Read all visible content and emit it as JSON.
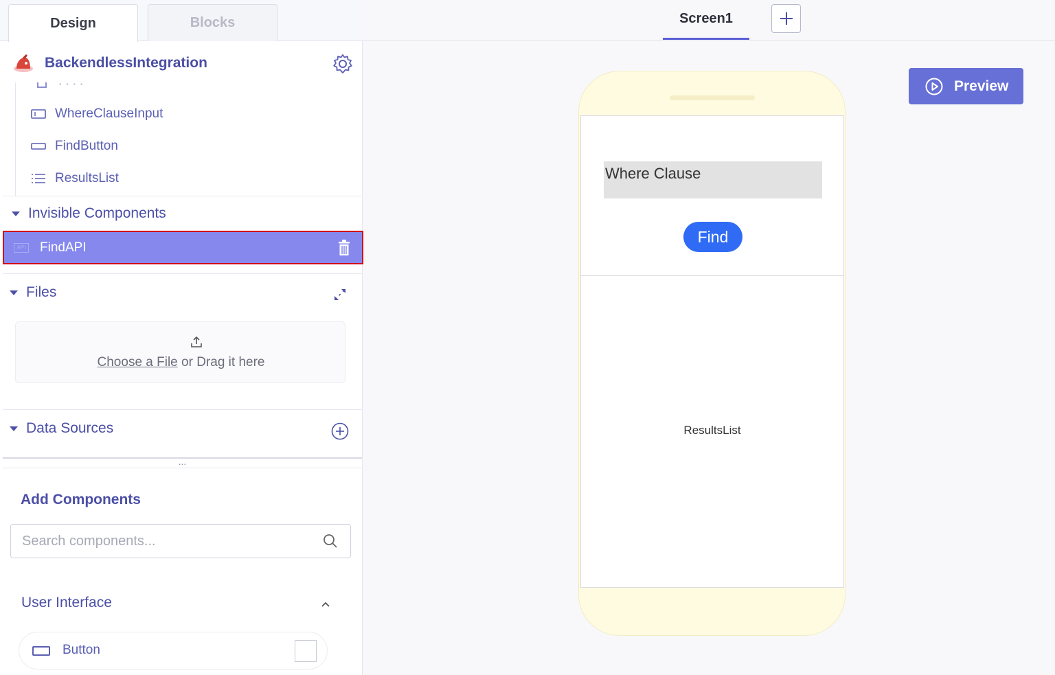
{
  "tabs": {
    "design": "Design",
    "blocks": "Blocks"
  },
  "project": {
    "name": "BackendlessIntegration"
  },
  "components_tree": {
    "items": [
      {
        "label": "WhereClauseInput",
        "icon": "textbox-icon"
      },
      {
        "label": "FindButton",
        "icon": "button-icon"
      },
      {
        "label": "ResultsList",
        "icon": "list-icon"
      }
    ]
  },
  "invisible": {
    "title": "Invisible Components",
    "selected_item": "FindAPI",
    "selected_icon_text": "API"
  },
  "files": {
    "title": "Files",
    "upload_link": "Choose a File",
    "upload_rest": " or Drag it here"
  },
  "data_sources": {
    "title": "Data Sources"
  },
  "resize_handle": "...",
  "add_components": {
    "title": "Add Components",
    "search_placeholder": "Search components...",
    "user_interface_title": "User Interface",
    "first_item": "Button"
  },
  "screen": {
    "tab_label": "Screen1",
    "add_symbol": "+"
  },
  "preview": {
    "label": "Preview"
  },
  "phone": {
    "where_clause_text": "Where Clause",
    "find_button_label": "Find",
    "results_list_label": "ResultsList"
  },
  "colors": {
    "accent": "#4b4fa6",
    "selected_row": "#8688ee",
    "highlight_border": "#d0021b",
    "preview_button": "#6770d6",
    "find_button": "#2f6bf4",
    "phone_frame": "#fffbe1"
  }
}
